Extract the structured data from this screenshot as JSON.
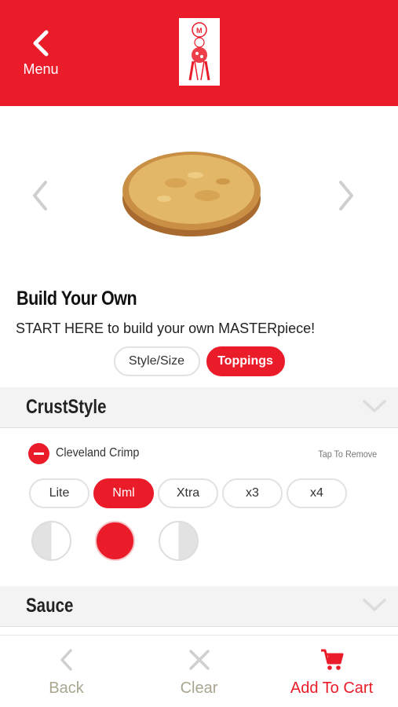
{
  "header": {
    "back_label": "Menu"
  },
  "product": {
    "title": "Build Your Own",
    "subtitle": "START HERE to build your own MASTERpiece!"
  },
  "tabs": [
    {
      "label": "Style/Size",
      "active": false
    },
    {
      "label": "Toppings",
      "active": true
    }
  ],
  "sections": {
    "crust": {
      "title": "CrustStyle",
      "topping": {
        "name": "Cleveland Crimp",
        "action_hint": "Tap To Remove"
      },
      "amounts": [
        "Lite",
        "Nml",
        "Xtra",
        "x3",
        "x4"
      ],
      "selected_amount": "Nml",
      "coverage": [
        "left-half",
        "whole",
        "right-half"
      ],
      "selected_coverage": "whole"
    },
    "sauce": {
      "title": "Sauce"
    }
  },
  "bottom_bar": {
    "back_label": "Back",
    "clear_label": "Clear",
    "cart_label": "Add To Cart"
  },
  "colors": {
    "brand_red": "#ea1c2a",
    "muted": "#a9a58f"
  }
}
